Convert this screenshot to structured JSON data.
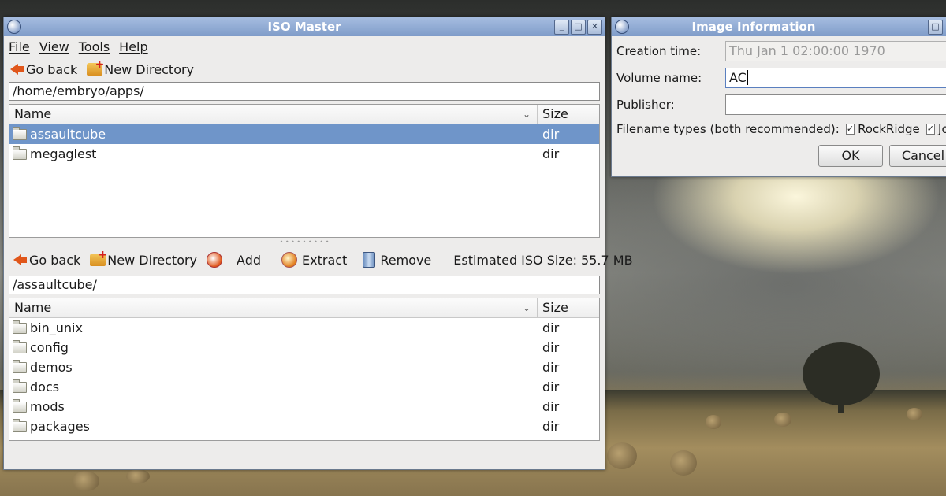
{
  "iso_master": {
    "title": "ISO Master",
    "window_buttons": [
      "_",
      "□",
      "✕"
    ],
    "menu": [
      "File",
      "View",
      "Tools",
      "Help"
    ],
    "top_toolbar": {
      "go_back": "Go back",
      "new_directory": "New Directory"
    },
    "top_path": "/home/embryo/apps/",
    "top_list": {
      "col_name": "Name",
      "col_size": "Size",
      "rows": [
        {
          "name": "assaultcube",
          "size": "dir",
          "selected": true
        },
        {
          "name": "megaglest",
          "size": "dir",
          "selected": false
        }
      ]
    },
    "bottom_toolbar": {
      "go_back": "Go back",
      "new_directory": "New Directory",
      "add": "Add",
      "extract": "Extract",
      "remove": "Remove",
      "iso_size": "Estimated ISO Size: 55.7 MB"
    },
    "bottom_path": "/assaultcube/",
    "bottom_list": {
      "col_name": "Name",
      "col_size": "Size",
      "rows": [
        {
          "name": "bin_unix",
          "size": "dir"
        },
        {
          "name": "config",
          "size": "dir"
        },
        {
          "name": "demos",
          "size": "dir"
        },
        {
          "name": "docs",
          "size": "dir"
        },
        {
          "name": "mods",
          "size": "dir"
        },
        {
          "name": "packages",
          "size": "dir"
        }
      ]
    }
  },
  "image_info": {
    "title": "Image Information",
    "creation_label": "Creation time:",
    "creation_value": "Thu Jan  1 02:00:00 1970",
    "volume_label": "Volume name:",
    "volume_value": "AC",
    "publisher_label": "Publisher:",
    "publisher_value": "",
    "filename_label": "Filename types (both recommended):",
    "rockridge": "RockRidge",
    "joliet": "Joliet",
    "ok": "OK",
    "cancel": "Cancel"
  }
}
